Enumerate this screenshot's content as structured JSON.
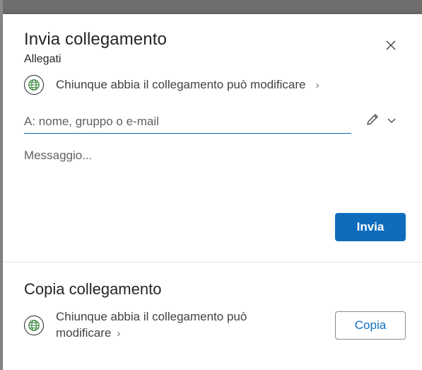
{
  "dialog": {
    "title": "Invia collegamento",
    "subtitle": "Allegati",
    "close_icon": "close-icon"
  },
  "send": {
    "permission_label": "Chiunque abbia il collegamento può modificare",
    "to_placeholder": "A: nome, gruppo o e-mail",
    "message_placeholder": "Messaggio...",
    "send_label": "Invia",
    "edit_icon": "pencil-icon",
    "dropdown_icon": "chevron-down-icon"
  },
  "copy": {
    "title": "Copia collegamento",
    "permission_label": "Chiunque abbia il collegamento può modificare",
    "copy_label": "Copia"
  },
  "colors": {
    "accent": "#0f6cbd",
    "text": "#242424",
    "muted_text": "#616161",
    "backdrop": "#6e6e6e"
  }
}
